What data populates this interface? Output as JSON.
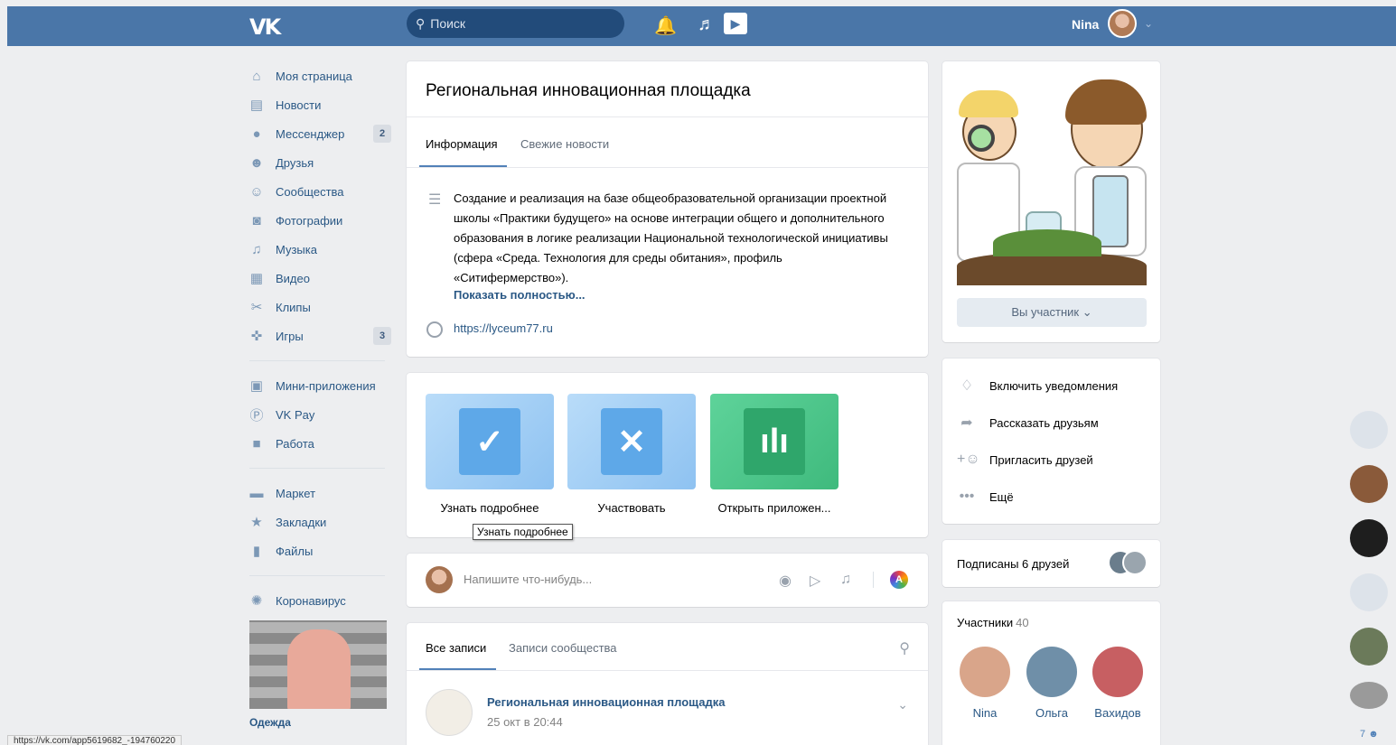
{
  "header": {
    "logo": "VK",
    "search_placeholder": "Поиск",
    "user_name": "Nina"
  },
  "sidebar": {
    "items": [
      {
        "label": "Моя страница",
        "icon": "home-icon"
      },
      {
        "label": "Новости",
        "icon": "news-icon"
      },
      {
        "label": "Мессенджер",
        "icon": "messenger-icon",
        "badge": "2"
      },
      {
        "label": "Друзья",
        "icon": "friends-icon"
      },
      {
        "label": "Сообщества",
        "icon": "groups-icon"
      },
      {
        "label": "Фотографии",
        "icon": "camera-icon"
      },
      {
        "label": "Музыка",
        "icon": "music-icon"
      },
      {
        "label": "Видео",
        "icon": "video-icon"
      },
      {
        "label": "Клипы",
        "icon": "clips-icon"
      },
      {
        "label": "Игры",
        "icon": "games-icon",
        "badge": "3"
      }
    ],
    "items2": [
      {
        "label": "Мини-приложения",
        "icon": "mini-apps-icon"
      },
      {
        "label": "VK Pay",
        "icon": "vkpay-icon"
      },
      {
        "label": "Работа",
        "icon": "briefcase-icon"
      }
    ],
    "items3": [
      {
        "label": "Маркет",
        "icon": "market-icon"
      },
      {
        "label": "Закладки",
        "icon": "star-icon"
      },
      {
        "label": "Файлы",
        "icon": "file-icon"
      }
    ],
    "items4": [
      {
        "label": "Коронавирус",
        "icon": "virus-icon"
      }
    ],
    "ad_title": "Одежда"
  },
  "group": {
    "title": "Региональная инновационная площадка",
    "tabs": [
      "Информация",
      "Свежие новости"
    ],
    "description": "Создание и реализация на базе общеобразовательной организации проектной школы «Практики будущего» на основе интеграции общего и дополнительного образования в логике реализации Национальной технологической инициативы (сфера «Среда. Технология для среды обитания», профиль «Ситифермерство»).",
    "show_more": "Показать полностью...",
    "site": "https://lyceum77.ru"
  },
  "apps": [
    {
      "label": "Узнать подробнее",
      "color_from": "#b9dcf9",
      "color_to": "#8ec2f1",
      "inner": "#5ea8e8",
      "glyph": "✓"
    },
    {
      "label": "Участвовать",
      "color_from": "#b9dcf9",
      "color_to": "#8ec2f1",
      "inner": "#5ea8e8",
      "glyph": "✕"
    },
    {
      "label": "Открыть приложен...",
      "color_from": "#5ed39a",
      "color_to": "#3fba7d",
      "inner": "#2fa66b",
      "glyph": "ılı"
    }
  ],
  "tooltip": "Узнать подробнее",
  "compose": {
    "placeholder": "Напишите что-нибудь..."
  },
  "wall": {
    "tabs": [
      "Все записи",
      "Записи сообщества"
    ],
    "post_author": "Региональная инновационная площадка",
    "post_date": "25 окт в 20:44"
  },
  "right": {
    "member_button": "Вы участник",
    "actions": [
      {
        "label": "Включить уведомления",
        "icon": "bell-icon"
      },
      {
        "label": "Рассказать друзьям",
        "icon": "share-icon"
      },
      {
        "label": "Пригласить друзей",
        "icon": "invite-icon"
      },
      {
        "label": "Ещё",
        "icon": "more-icon"
      }
    ],
    "friends_subscribed": "Подписаны 6 друзей",
    "members_title": "Участники",
    "members_count": "40",
    "members": [
      {
        "name": "Nina",
        "color": "#d9a58a"
      },
      {
        "name": "Ольга",
        "color": "#6f8fa8"
      },
      {
        "name": "Вахидов",
        "color": "#c75f62"
      }
    ]
  },
  "strip_count": "7",
  "status_url": "https://vk.com/app5619682_-194760220"
}
